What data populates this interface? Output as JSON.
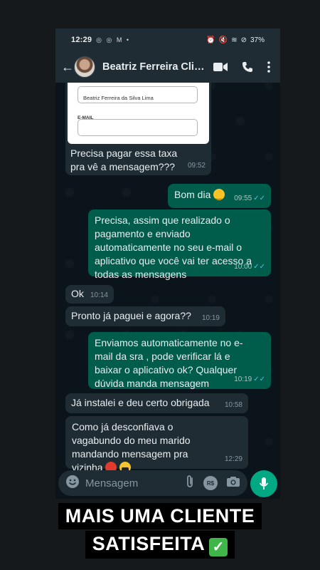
{
  "status_bar": {
    "time": "12:29",
    "notif_icons": "◎ ◎ M •",
    "battery": "37%"
  },
  "header": {
    "contact_name": "Beatriz Ferreira Clie…",
    "video_icon": "video-call-icon",
    "call_icon": "phone-icon",
    "menu_icon": "more-vert-icon"
  },
  "form_image": {
    "name_value": "Beatriz Ferreira da Silva Lima",
    "email_label": "E-MAIL"
  },
  "messages": [
    {
      "dir": "in",
      "text": "Precisa pagar essa taxa pra vê a mensagem???",
      "time": "09:52"
    },
    {
      "dir": "out",
      "text": "Bom dia",
      "time": "09:55"
    },
    {
      "dir": "out",
      "text": "Precisa, assim que realizado o pagamento e enviado automaticamente no seu e-mail o aplicativo que você vai ter acesso a todas as mensagens",
      "time": "10:00"
    },
    {
      "dir": "in",
      "text": "Ok",
      "time": "10:14"
    },
    {
      "dir": "in",
      "text": "Pronto já paguei e agora??",
      "time": "10:19"
    },
    {
      "dir": "out",
      "text": "Enviamos automaticamente no e-mail da sra , pode verificar lá e baixar o aplicativo ok? Qualquer dúvida manda mensagem",
      "time": "10:19"
    },
    {
      "dir": "in",
      "text": "Já instalei e deu certo obrigada",
      "time": "10:58"
    },
    {
      "dir": "in",
      "text": "Como já desconfiava o vagabundo do meu marido mandando mensagem pra vizinha",
      "time": "12:29"
    }
  ],
  "composer": {
    "placeholder": "Mensagem",
    "currency_icon_label": "R$"
  },
  "caption": {
    "line1": "MAIS UMA CLIENTE",
    "line2": "SATISFEITA"
  },
  "colors": {
    "incoming": "#1f2c34",
    "outgoing": "#005c4b",
    "accent": "#00a884",
    "read_tick": "#53bdeb"
  }
}
